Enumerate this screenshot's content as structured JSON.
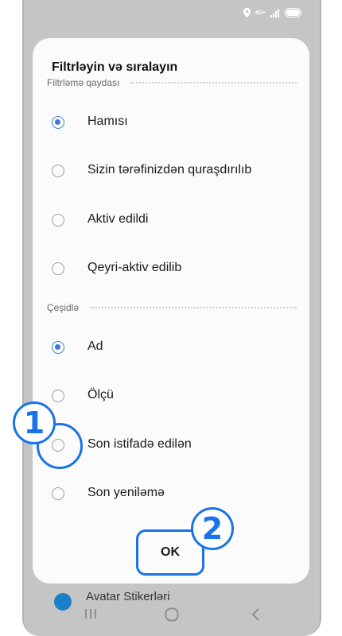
{
  "status_bar": {
    "network": "4G+"
  },
  "dialog": {
    "title": "Filtrləyin və sıralayın",
    "filter_section": {
      "label": "Filtrləmə qaydası",
      "options": [
        {
          "label": "Hamısı",
          "checked": true
        },
        {
          "label": "Sizin tərəfinizdən quraşdırılıb",
          "checked": false
        },
        {
          "label": "Aktiv edildi",
          "checked": false
        },
        {
          "label": "Qeyri-aktiv edilib",
          "checked": false
        }
      ]
    },
    "sort_section": {
      "label": "Çeşidlə",
      "options": [
        {
          "label": "Ad",
          "checked": true
        },
        {
          "label": "Ölçü",
          "checked": false
        },
        {
          "label": "Son istifadə edilən",
          "checked": false
        },
        {
          "label": "Son yeniləmə",
          "checked": false
        }
      ]
    },
    "ok_label": "OK"
  },
  "background": {
    "item_label": "Avatar Stikerləri"
  },
  "callouts": {
    "step1": "1",
    "step2": "2"
  },
  "colors": {
    "accent": "#1a73e8",
    "radio_selected": "#3e7bd9",
    "overlay": "#c5c5c5"
  }
}
